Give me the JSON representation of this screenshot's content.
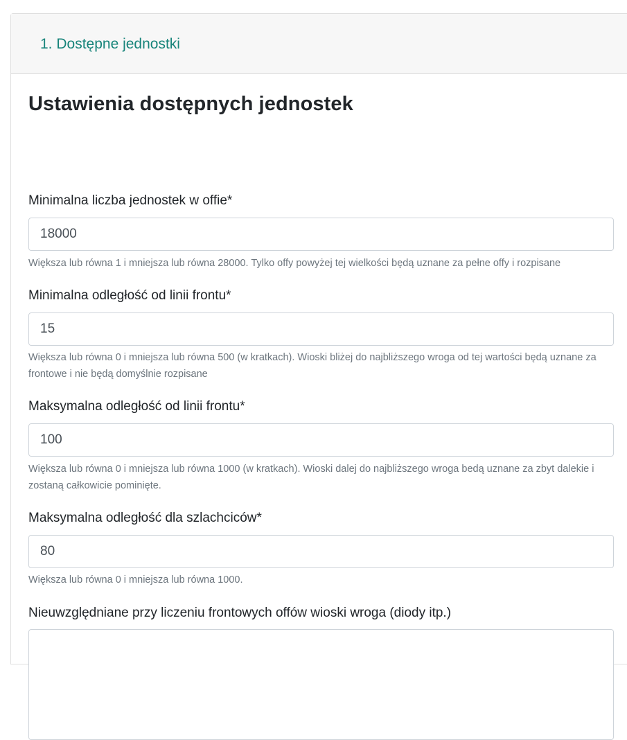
{
  "header": {
    "title": "1. Dostępne jednostki"
  },
  "section": {
    "title": "Ustawienia dostępnych jednostek"
  },
  "fields": [
    {
      "label": "Minimalna liczba jednostek w offie*",
      "value": "18000",
      "help": "Większa lub równa 1 i mniejsza lub równa 28000. Tylko offy powyżej tej wielkości będą uznane za pełne offy i rozpisane"
    },
    {
      "label": "Minimalna odległość od linii frontu*",
      "value": "15",
      "help": "Większa lub równa 0 i mniejsza lub równa 500 (w kratkach). Wioski bliżej do najbliższego wroga od tej wartości będą uznane za frontowe i nie będą domyślnie rozpisane"
    },
    {
      "label": "Maksymalna odległość od linii frontu*",
      "value": "100",
      "help": "Większa lub równa 0 i mniejsza lub równa 1000 (w kratkach). Wioski dalej do najbliższego wroga bedą uznane za zbyt dalekie i zostaną całkowicie pominięte."
    },
    {
      "label": "Maksymalna odległość dla szlachciców*",
      "value": "80",
      "help": "Większa lub równa 0 i mniejsza lub równa 1000."
    }
  ],
  "textarea_field": {
    "label": "Nieuwzględniane przy liczeniu frontowych offów wioski wroga (diody itp.)",
    "value": ""
  }
}
